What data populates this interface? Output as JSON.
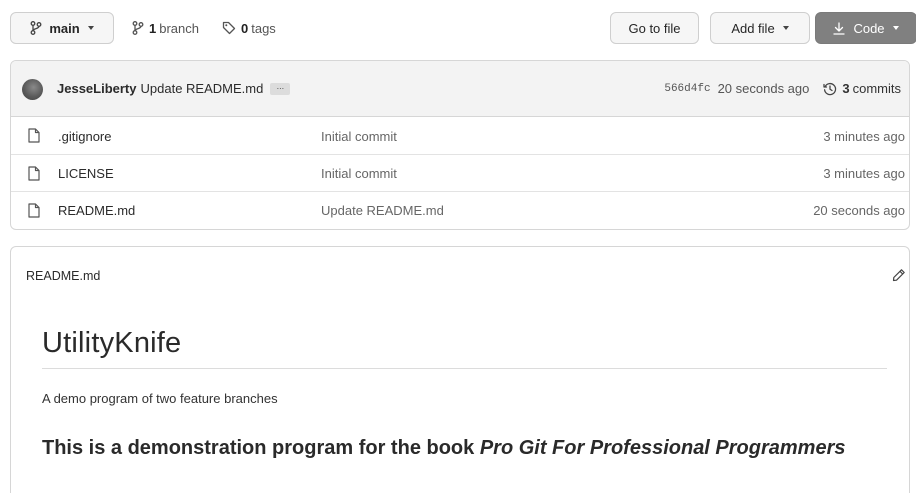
{
  "toolbar": {
    "branch_name": "main",
    "branches_count": "1",
    "branches_label": "branch",
    "tags_count": "0",
    "tags_label": "tags",
    "goto_label": "Go to file",
    "addfile_label": "Add file",
    "code_label": "Code"
  },
  "commit": {
    "author": "JesseLiberty",
    "message": "Update README.md",
    "ellipsis": "...",
    "sha": "566d4fc",
    "time": "20 seconds ago",
    "commits_count": "3",
    "commits_label": "commits"
  },
  "files": [
    {
      "name": ".gitignore",
      "message": "Initial commit",
      "age": "3 minutes ago"
    },
    {
      "name": "LICENSE",
      "message": "Initial commit",
      "age": "3 minutes ago"
    },
    {
      "name": "README.md",
      "message": "Update README.md",
      "age": "20 seconds ago"
    }
  ],
  "readme": {
    "file_title": "README.md",
    "h1": "UtilityKnife",
    "paragraph": "A demo program of two feature branches",
    "h2_prefix": "This is a demonstration program for the book ",
    "h2_italic": "Pro Git For Professional Programmers"
  },
  "icons": {
    "branch": "git-branch-icon",
    "tag": "tag-icon",
    "download": "download-icon",
    "history": "history-icon",
    "file": "file-icon",
    "edit": "pencil-icon"
  },
  "colors": {
    "code_button_bg": "#808080",
    "commit_bar_bg": "#f3f3f3"
  }
}
